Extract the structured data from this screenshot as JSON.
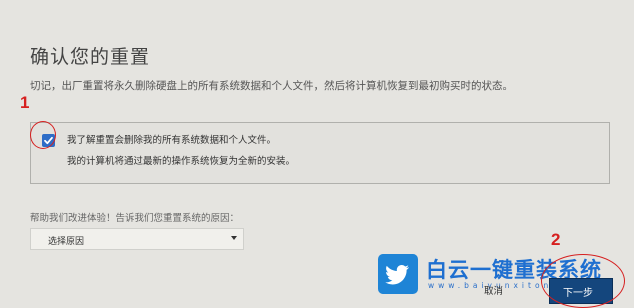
{
  "page": {
    "title": "确认您的重置",
    "warning": "切记，出厂重置将永久删除硬盘上的所有系统数据和个人文件，然后将计算机恢复到最初购买时的状态。"
  },
  "confirm": {
    "checked": true,
    "label": "我了解重置会删除我的所有系统数据和个人文件。",
    "note": "我的计算机将通过最新的操作系统恢复为全新的安装。"
  },
  "feedback": {
    "label": "帮助我们改进体验！告诉我们您重置系统的原因：",
    "select_value": "选择原因"
  },
  "buttons": {
    "cancel": "取消",
    "next": "下一步"
  },
  "annotations": {
    "step1": "1",
    "step2": "2",
    "color": "#d62020"
  },
  "watermark": {
    "title": "白云一键重装系统",
    "url": "www.baiyunxitong.com",
    "icon": "twitter-bird-icon"
  },
  "colors": {
    "background": "#e5e4e0",
    "checkbox": "#2e6dc7",
    "next_button": "#14467d",
    "watermark": "#1e6fd0"
  }
}
